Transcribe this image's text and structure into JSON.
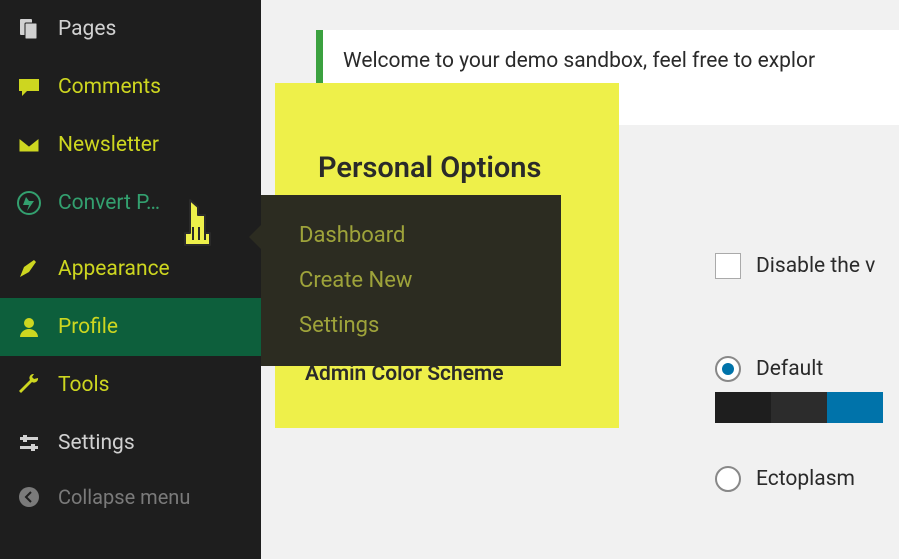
{
  "sidebar": {
    "items": [
      {
        "label": "Pages",
        "icon": "pages-icon",
        "style": "default"
      },
      {
        "label": "Comments",
        "icon": "comments-icon",
        "style": "yellow"
      },
      {
        "label": "Newsletter",
        "icon": "newsletter-icon",
        "style": "yellow"
      },
      {
        "label": "Convert P…",
        "icon": "convertpro-icon",
        "style": "green"
      },
      {
        "label": "Appearance",
        "icon": "appearance-icon",
        "style": "yellow"
      },
      {
        "label": "Profile",
        "icon": "profile-icon",
        "style": "current"
      },
      {
        "label": "Tools",
        "icon": "tools-icon",
        "style": "yellow"
      },
      {
        "label": "Settings",
        "icon": "settings-icon",
        "style": "default"
      }
    ],
    "collapse_label": "Collapse menu"
  },
  "submenu": {
    "items": [
      {
        "label": "Dashboard"
      },
      {
        "label": "Create New"
      },
      {
        "label": "Settings"
      }
    ]
  },
  "notice": {
    "text": "Welcome to your demo sandbox, feel free to explor\nanything."
  },
  "section": {
    "title": "Personal Options",
    "admin_color_label": "Admin Color Scheme",
    "visual_editor_label": "Disable the v",
    "schemes": {
      "default_label": "Default",
      "ectoplasm_label": "Ectoplasm"
    }
  },
  "colors": {
    "highlight": "#eef04a",
    "sidebar_bg": "#1e1e1e",
    "current_bg": "#0d5f3c",
    "accent_yellow": "#cdd620",
    "accent_green": "#33a06f",
    "notice_border": "#3ba13f",
    "radio_checked": "#0073aa"
  }
}
